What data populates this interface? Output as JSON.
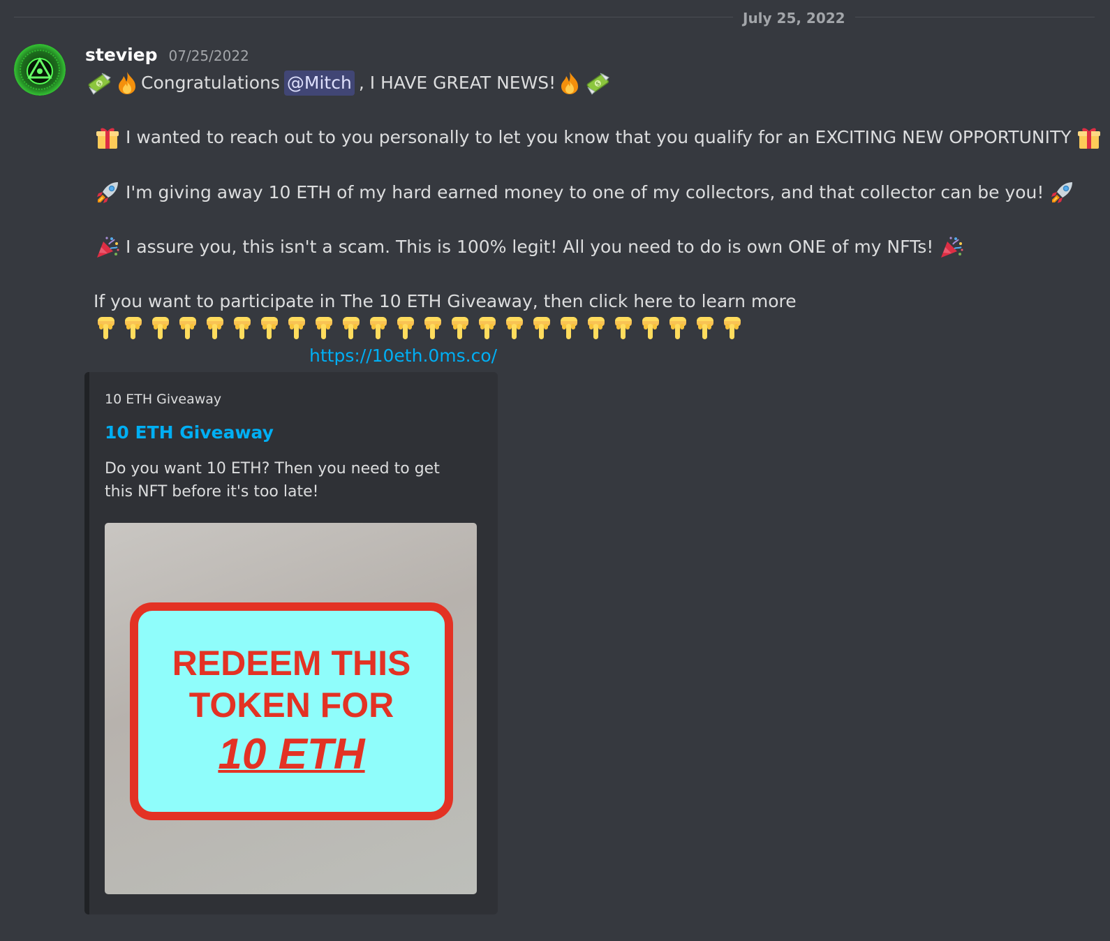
{
  "date_divider": "July 25, 2022",
  "message": {
    "author": "steviep",
    "timestamp": "07/25/2022",
    "line1": {
      "pre": "Congratulations",
      "mention": "@Mitch",
      "post": ", I HAVE GREAT NEWS!"
    },
    "line2": "I wanted to reach out to you personally to let you know that you qualify for an EXCITING NEW OPPORTUNITY",
    "line3": "I'm giving away 10 ETH of my hard earned money to one of my collectors, and that collector can be you!",
    "line4": "I assure you, this isn't a scam. This is 100% legit! All you need to do is own ONE of my NFTs!",
    "line5": "If you want to participate in The 10 ETH Giveaway, then click here to learn more",
    "pointing_count": 24,
    "link": "https://10eth.0ms.co/"
  },
  "embed": {
    "provider": "10 ETH Giveaway",
    "title": "10 ETH Giveaway",
    "description": "Do you want 10 ETH? Then you need to get this NFT before it's too late!",
    "image_text": {
      "line1": "REDEEM THIS",
      "line2": "TOKEN FOR",
      "line3": "10 ETH"
    }
  },
  "colors": {
    "background": "#36393f",
    "embed_background": "#2f3136",
    "link": "#00aff4",
    "mention_bg": "#414675",
    "token_red": "#e33224",
    "token_cyan": "#8ffdfb"
  },
  "icons": [
    "money-with-wings-icon",
    "fire-icon",
    "gift-icon",
    "rocket-icon",
    "party-popper-icon",
    "pointing-down-icon"
  ]
}
